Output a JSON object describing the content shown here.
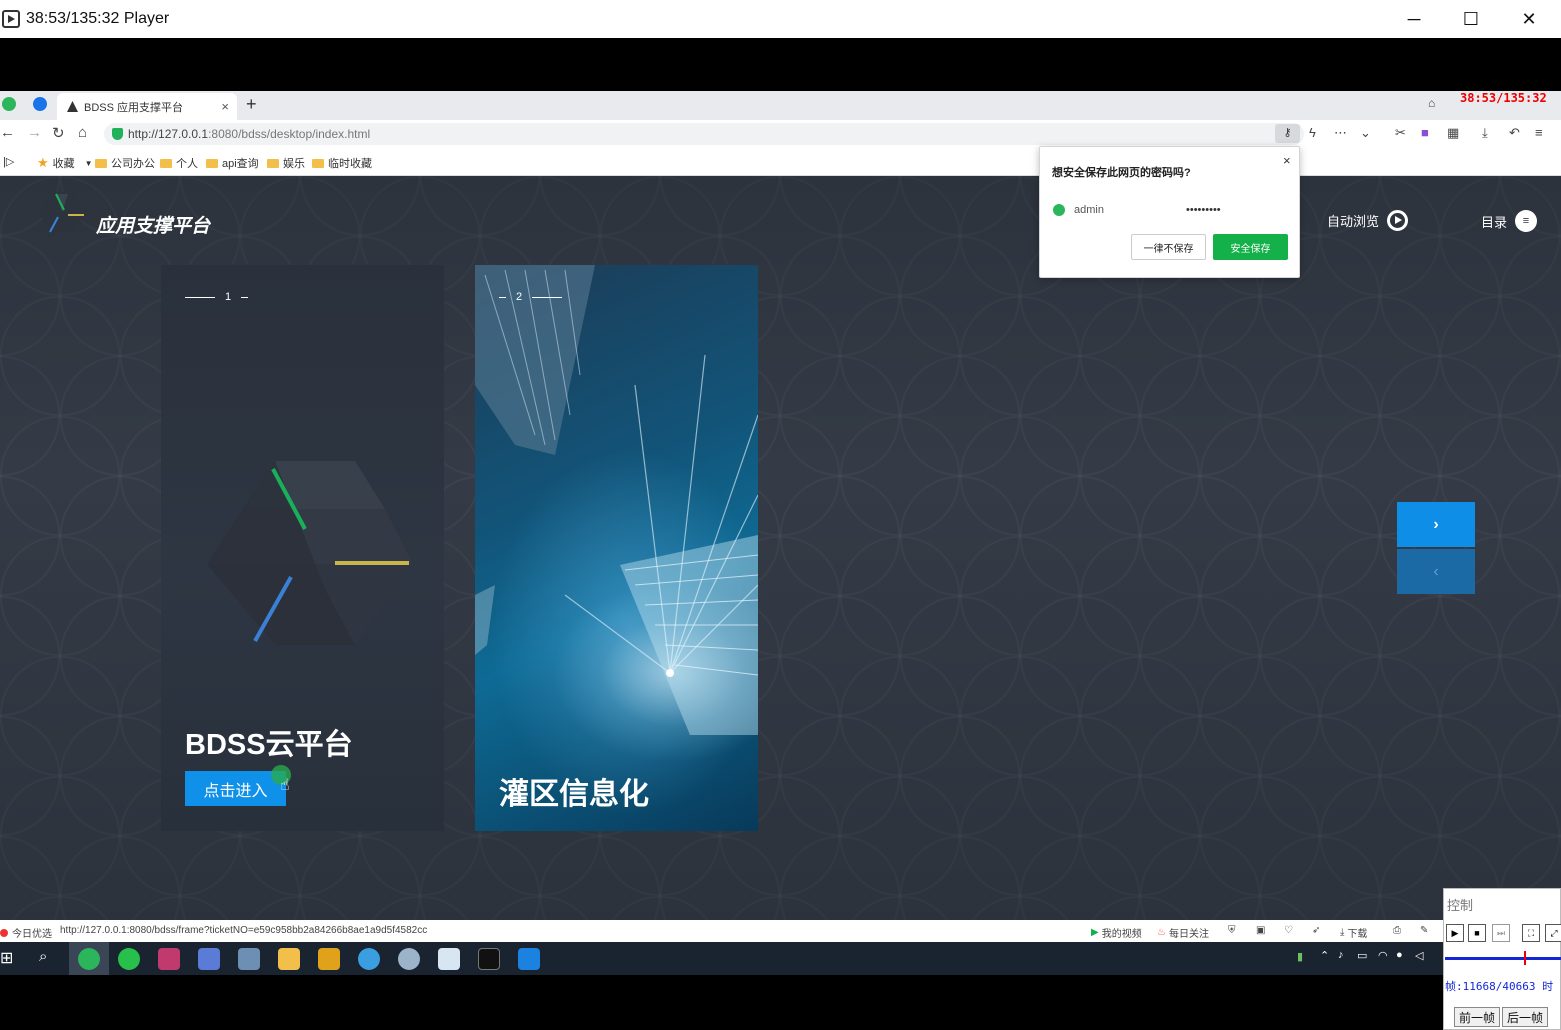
{
  "player": {
    "title": "38:53/135:32 Player",
    "minimize": "─",
    "maximize": "☐",
    "close": "✕",
    "timecode": "38:53/135:32"
  },
  "browser": {
    "tab_title": "BDSS 应用支撑平台",
    "tab_close": "×",
    "new_tab": "+",
    "url_host": "http://127.0.0.1",
    "url_path": ":8080/bdss/desktop/index.html",
    "bookmarks": [
      "收藏",
      "公司办公",
      "个人",
      "api查询",
      "娱乐",
      "临时收藏"
    ]
  },
  "page": {
    "site_title": "应用支撑平台",
    "auto_browse": "自动浏览",
    "menu": "目录",
    "cards": [
      {
        "num": "1",
        "title": "BDSS云平台",
        "button": "点击进入"
      },
      {
        "num": "2",
        "title": "灌区信息化"
      }
    ],
    "next_arrow": "›",
    "prev_arrow": "‹"
  },
  "password_popup": {
    "question": "想安全保存此网页的密码吗?",
    "username": "admin",
    "password_mask": "•••••••••",
    "never_button": "一律不保存",
    "save_button": "安全保存",
    "close": "×"
  },
  "statusbar": {
    "left_label": "今日优选",
    "link_url": "http://127.0.0.1:8080/bdss/frame?ticketNO=e59c958bb2a84266b8ae1a9d5f4582cc",
    "my_video": "我的视频",
    "daily_follow": "每日关注",
    "download": "下载"
  },
  "control_panel": {
    "title": "控制",
    "frames": "帧:11668/40663 时",
    "prev_frame": "前一帧",
    "next_frame": "后一帧"
  },
  "colors": {
    "accent_blue": "#0f91ea",
    "save_green": "#14b04a",
    "page_bg": "#343b46"
  }
}
